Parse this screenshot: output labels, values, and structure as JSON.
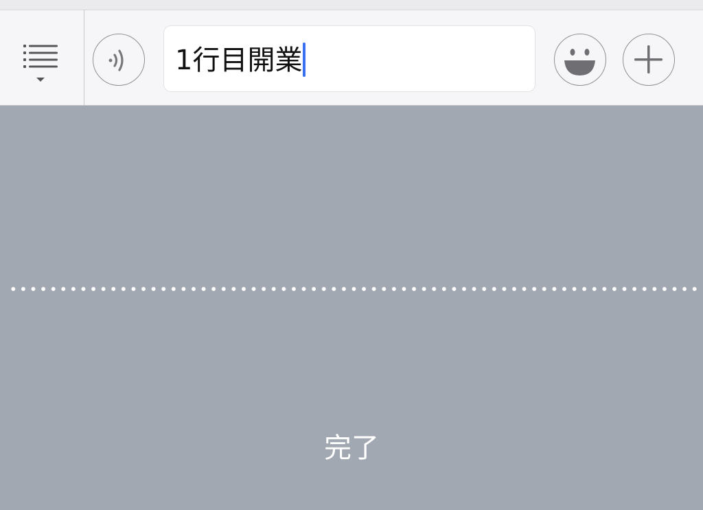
{
  "toolbar": {
    "menu_icon": "list-menu-icon",
    "voice_icon": "voice-wave-icon",
    "emoji_icon": "smiley-face-icon",
    "plus_icon": "plus-icon"
  },
  "input": {
    "value": "1行目開業",
    "caret_color": "#3b6ff2"
  },
  "keyboard_area": {
    "done_label": "完了",
    "background_color": "#a2a8b1"
  }
}
